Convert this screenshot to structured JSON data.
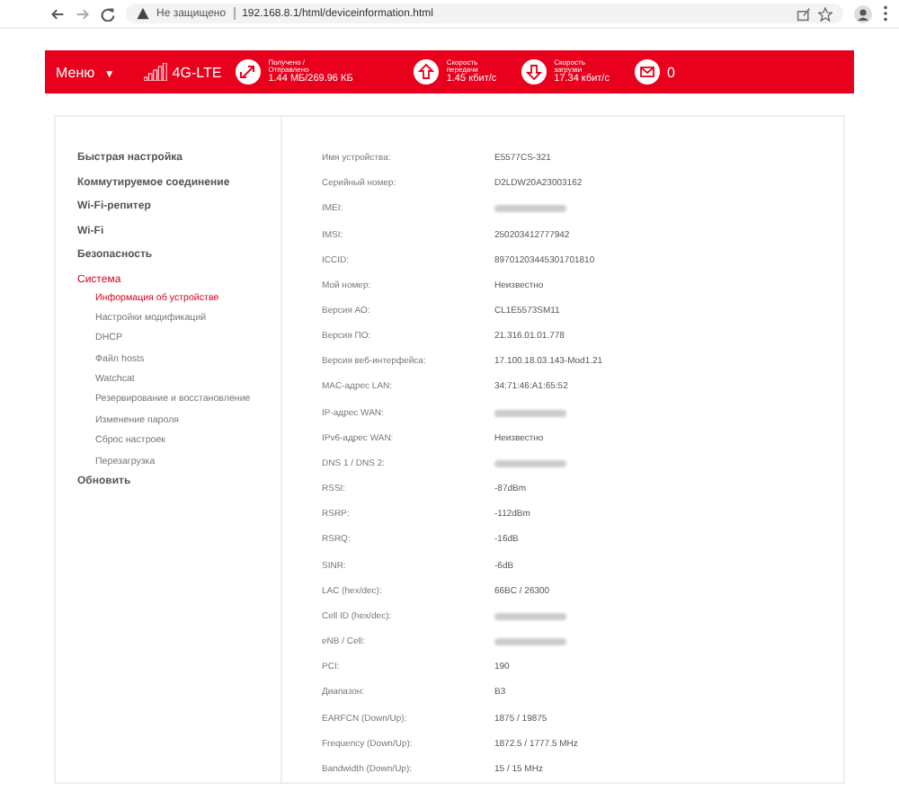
{
  "browser": {
    "security": "Не защищено",
    "url": "192.168.8.1/html/deviceinformation.html"
  },
  "header": {
    "menu": "Меню",
    "caret": "▼",
    "network": "4G-LTE",
    "stats": [
      {
        "kind": "traffic",
        "label": "Получено /\nОтправлено",
        "value": "1.44 МБ/269.96 КБ"
      },
      {
        "kind": "upload",
        "label": "Скорость\nпередачи",
        "value": "1.45 кбит/с"
      },
      {
        "kind": "download",
        "label": "Скорость\nзагрузки",
        "value": "17.34 кбит/с"
      },
      {
        "kind": "messages",
        "value": "0"
      }
    ]
  },
  "sidebar": {
    "items": [
      {
        "label": "Быстрая настройка",
        "selected": false
      },
      {
        "label": "Коммутируемое соединение",
        "selected": false
      },
      {
        "label": "Wi-Fi-репитер",
        "selected": false
      },
      {
        "label": "Wi-Fi",
        "selected": false
      },
      {
        "label": "Безопасность",
        "selected": false
      },
      {
        "label": "Система",
        "selected": true,
        "children": [
          {
            "label": "Информация об устройстве",
            "selected": true
          },
          {
            "label": "Настройки модификаций",
            "selected": false
          },
          {
            "label": "DHCP",
            "selected": false
          },
          {
            "label": "Файл hosts",
            "selected": false
          },
          {
            "label": "Watchcat",
            "selected": false
          },
          {
            "label": "Резервирование и восстановление",
            "selected": false
          },
          {
            "label": "Изменение пароля",
            "selected": false
          },
          {
            "label": "Сброс настроек",
            "selected": false
          },
          {
            "label": "Перезагрузка",
            "selected": false
          }
        ]
      },
      {
        "label": "Обновить",
        "selected": false
      }
    ]
  },
  "info": {
    "rows": [
      {
        "label": "Имя устройства:",
        "value": "E5577CS-321"
      },
      {
        "label": "Серийный номер:",
        "value": "D2LDW20A23003162"
      },
      {
        "label": "IMEI:",
        "blurred": true
      },
      {
        "label": "IMSI:",
        "value": "250203412777942"
      },
      {
        "label": "ICCID:",
        "value": "89701203445301701810"
      },
      {
        "label": "Мой номер:",
        "value": "Неизвестно"
      },
      {
        "label": "Версия АО:",
        "value": "CL1E5573SM11"
      },
      {
        "label": "Версия ПО:",
        "value": "21.316.01.01.778"
      },
      {
        "label": "Версия веб-интерфейса:",
        "value": "17.100.18.03.143-Mod1.21"
      },
      {
        "label": "MAC-адрес LAN:",
        "value": "34:71:46:A1:65:52"
      },
      {
        "label": "IP-адрес WAN:",
        "blurred": true
      },
      {
        "label": "IPv6-адрес WAN:",
        "value": "Неизвестно"
      },
      {
        "label": "DNS 1 / DNS 2:",
        "blurred": true
      },
      {
        "label": "RSSI:",
        "value": "-87dBm"
      },
      {
        "label": "RSRP:",
        "value": "-112dBm"
      },
      {
        "label": "RSRQ:",
        "value": "-16dB"
      },
      {
        "label": "SINR:",
        "value": "-6dB"
      },
      {
        "label": "LAC (hex/dec):",
        "value": "66BC / 26300"
      },
      {
        "label": "Cell ID (hex/dec):",
        "blurred": true
      },
      {
        "label": "eNB / Cell:",
        "blurred": true
      },
      {
        "label": "PCI:",
        "value": "190"
      },
      {
        "label": "Диапазон:",
        "value": "B3"
      },
      {
        "label": "EARFCN (Down/Up):",
        "value": "1875 / 19875"
      },
      {
        "label": "Frequency (Down/Up):",
        "value": "1872.5 / 1777.5 MHz"
      },
      {
        "label": "Bandwidth (Down/Up):",
        "value": "15 / 15 MHz"
      }
    ]
  }
}
